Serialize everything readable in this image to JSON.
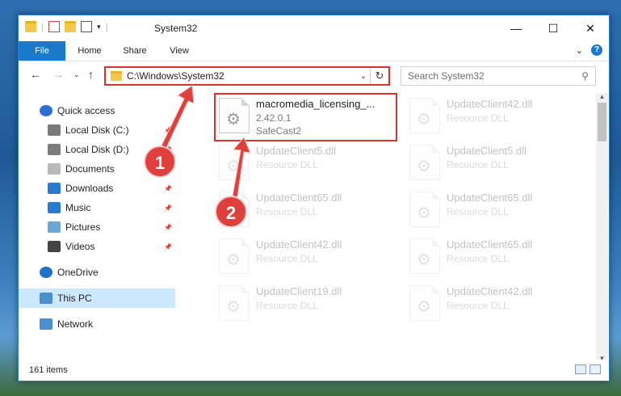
{
  "window": {
    "title": "System32",
    "buttons": {
      "minimize": "—",
      "maximize": "☐",
      "close": "✕"
    }
  },
  "ribbon": {
    "tabs": [
      "File",
      "Home",
      "Share",
      "View"
    ],
    "expand": "⌄",
    "help": "?"
  },
  "navigation": {
    "address": "C:\\Windows\\System32",
    "search_placeholder": "Search System32"
  },
  "sidebar": {
    "items": [
      {
        "label": "Quick access",
        "icon": "star-icon",
        "color": "#2b6fd6"
      },
      {
        "label": "Local Disk (C:)",
        "icon": "drive-icon",
        "pinned": true
      },
      {
        "label": "Local Disk (D:)",
        "icon": "drive-icon",
        "pinned": true
      },
      {
        "label": "Documents",
        "icon": "documents-icon",
        "pinned": true
      },
      {
        "label": "Downloads",
        "icon": "downloads-icon",
        "pinned": true
      },
      {
        "label": "Music",
        "icon": "music-icon",
        "pinned": true
      },
      {
        "label": "Pictures",
        "icon": "pictures-icon",
        "pinned": true
      },
      {
        "label": "Videos",
        "icon": "videos-icon",
        "pinned": true
      },
      {
        "label": "OneDrive",
        "icon": "cloud-icon"
      },
      {
        "label": "This PC",
        "icon": "computer-icon",
        "selected": true
      },
      {
        "label": "Network",
        "icon": "network-icon"
      }
    ]
  },
  "files": [
    {
      "name": "macromedia_licensing_...",
      "line1": "2.42.0.1",
      "line2": "SafeCast2",
      "highlighted": true
    },
    {
      "name": "UpdateClient42.dll",
      "line1": "Resource DLL",
      "faded": true
    },
    {
      "name": "UpdateClient5.dll",
      "line1": "Resource DLL",
      "faded": true
    },
    {
      "name": "UpdateClient5.dll",
      "line1": "Resource DLL",
      "faded": true
    },
    {
      "name": "UpdateClient65.dll",
      "line1": "Resource DLL",
      "faded": true
    },
    {
      "name": "UpdateClient65.dll",
      "line1": "Resource DLL",
      "faded": true
    },
    {
      "name": "UpdateClient42.dll",
      "line1": "Resource DLL",
      "faded": true
    },
    {
      "name": "UpdateClient65.dll",
      "line1": "Resource DLL",
      "faded": true
    },
    {
      "name": "UpdateClient19.dll",
      "line1": "Resource DLL",
      "faded": true
    },
    {
      "name": "UpdateClient42.dll",
      "line1": "Resource DLL",
      "faded": true
    }
  ],
  "status": {
    "item_count": "161 items"
  },
  "callouts": [
    "1",
    "2"
  ],
  "colors": {
    "accent": "#1979ca",
    "highlight": "#d9322f",
    "selection": "#cce8ff"
  }
}
